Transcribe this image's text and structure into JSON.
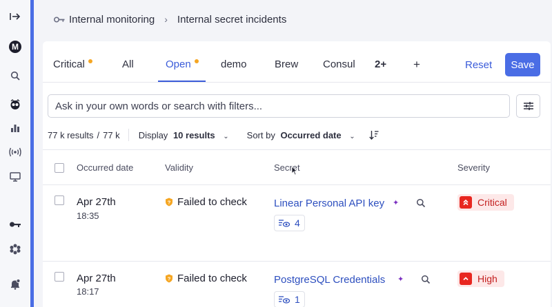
{
  "rail": {
    "icons": [
      "expand-icon",
      "account-avatar-icon",
      "search-icon",
      "guardian-icon",
      "analytics-icon",
      "broadcast-icon",
      "monitor-icon",
      "key-icon",
      "integrations-icon",
      "alerts-icon"
    ],
    "avatar_letter": "M"
  },
  "breadcrumb": {
    "root": "Internal monitoring",
    "current": "Internal secret incidents"
  },
  "tabs": [
    {
      "label": "Critical",
      "dot": true
    },
    {
      "label": "All",
      "dot": false
    },
    {
      "label": "Open",
      "dot": true,
      "active": true
    },
    {
      "label": "demo",
      "dot": false
    },
    {
      "label": "Brew",
      "dot": false
    },
    {
      "label": "Consul",
      "dot": false
    },
    {
      "label": "2+",
      "dot": false
    },
    {
      "label": "+",
      "dot": false
    }
  ],
  "actions": {
    "reset": "Reset",
    "save": "Save"
  },
  "search": {
    "placeholder": "Ask in your own words or search with filters..."
  },
  "results": {
    "count": "77 k results",
    "separator": "/",
    "total": "77 k",
    "display_label": "Display",
    "display_value": "10 results",
    "sort_label": "Sort by",
    "sort_value": "Occurred date"
  },
  "table": {
    "headers": {
      "occurred": "Occurred date",
      "validity": "Validity",
      "secret": "Secret",
      "severity": "Severity"
    },
    "rows": [
      {
        "date": "Apr 27th",
        "time": "18:35",
        "validity": "Failed to check",
        "secret": "Linear Personal API key",
        "occurrences": "4",
        "severity": "Critical"
      },
      {
        "date": "Apr 27th",
        "time": "18:17",
        "validity": "Failed to check",
        "secret": "PostgreSQL Credentials",
        "occurrences": "1",
        "severity": "High"
      }
    ]
  },
  "colors": {
    "accent": "#4a6de5",
    "link": "#2d4fbf",
    "tab_dot": "#f5a623",
    "severity_red": "#e8261f",
    "severity_bg": "#fde8e8",
    "validity_orange": "#f5a623"
  }
}
